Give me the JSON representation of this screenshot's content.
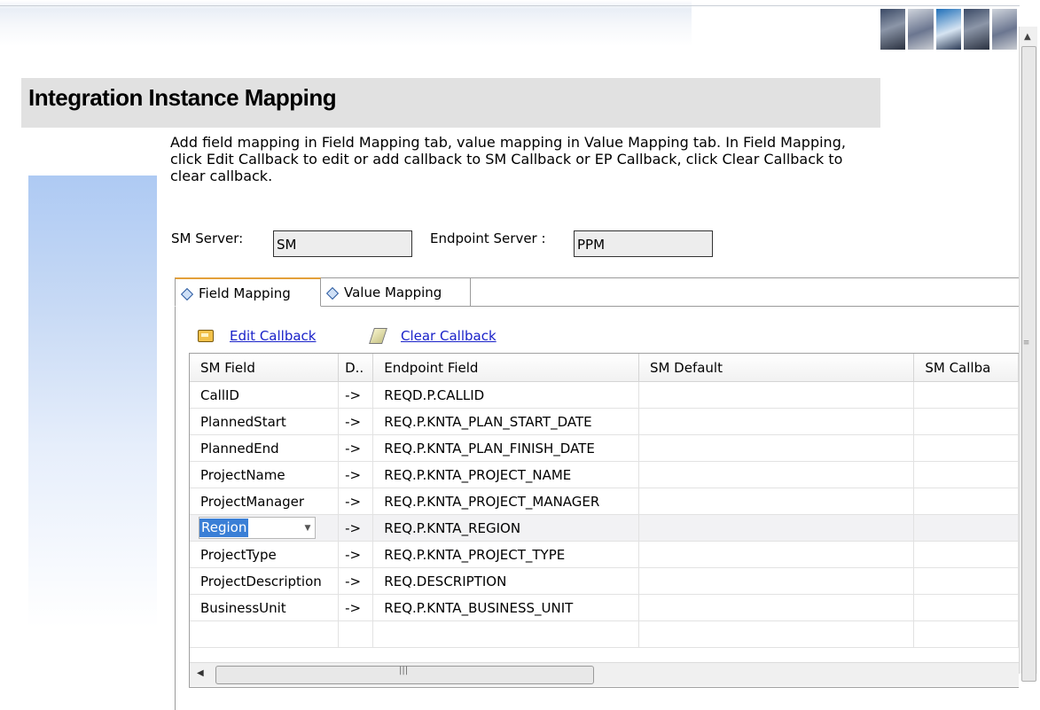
{
  "page": {
    "title": "Integration Instance Mapping",
    "description": "Add field mapping in Field Mapping tab, value mapping in Value Mapping tab. In Field Mapping, click Edit Callback to edit or add callback to SM Callback or EP Callback, click Clear Callback to clear callback."
  },
  "servers": {
    "sm_label": "SM Server:",
    "sm_value": "SM",
    "ep_label": "Endpoint Server :",
    "ep_value": "PPM"
  },
  "tabs": [
    {
      "label": "Field Mapping",
      "active": true
    },
    {
      "label": "Value Mapping",
      "active": false
    }
  ],
  "toolbar": {
    "edit_callback": "Edit Callback",
    "clear_callback": "Clear Callback"
  },
  "table": {
    "columns": [
      "SM Field",
      "D..",
      "Endpoint Field",
      "SM Default",
      "SM Callba"
    ],
    "rows": [
      {
        "sm": "CallID",
        "dir": "->",
        "ep": "REQD.P.CALLID"
      },
      {
        "sm": "PlannedStart",
        "dir": "->",
        "ep": "REQ.P.KNTA_PLAN_START_DATE"
      },
      {
        "sm": "PlannedEnd",
        "dir": "->",
        "ep": "REQ.P.KNTA_PLAN_FINISH_DATE"
      },
      {
        "sm": "ProjectName",
        "dir": "->",
        "ep": "REQ.P.KNTA_PROJECT_NAME"
      },
      {
        "sm": "ProjectManager",
        "dir": "->",
        "ep": "REQ.P.KNTA_PROJECT_MANAGER"
      },
      {
        "sm": "Region",
        "dir": "->",
        "ep": "REQ.P.KNTA_REGION",
        "editing": true
      },
      {
        "sm": "ProjectType",
        "dir": "->",
        "ep": "REQ.P.KNTA_PROJECT_TYPE"
      },
      {
        "sm": "ProjectDescription",
        "dir": "->",
        "ep": "REQ.DESCRIPTION"
      },
      {
        "sm": "BusinessUnit",
        "dir": "->",
        "ep": "REQ.P.KNTA_BUSINESS_UNIT"
      }
    ]
  },
  "icons": {
    "edit": "edit-callback-icon",
    "clear": "clear-callback-icon",
    "tab": "diamond-icon"
  }
}
